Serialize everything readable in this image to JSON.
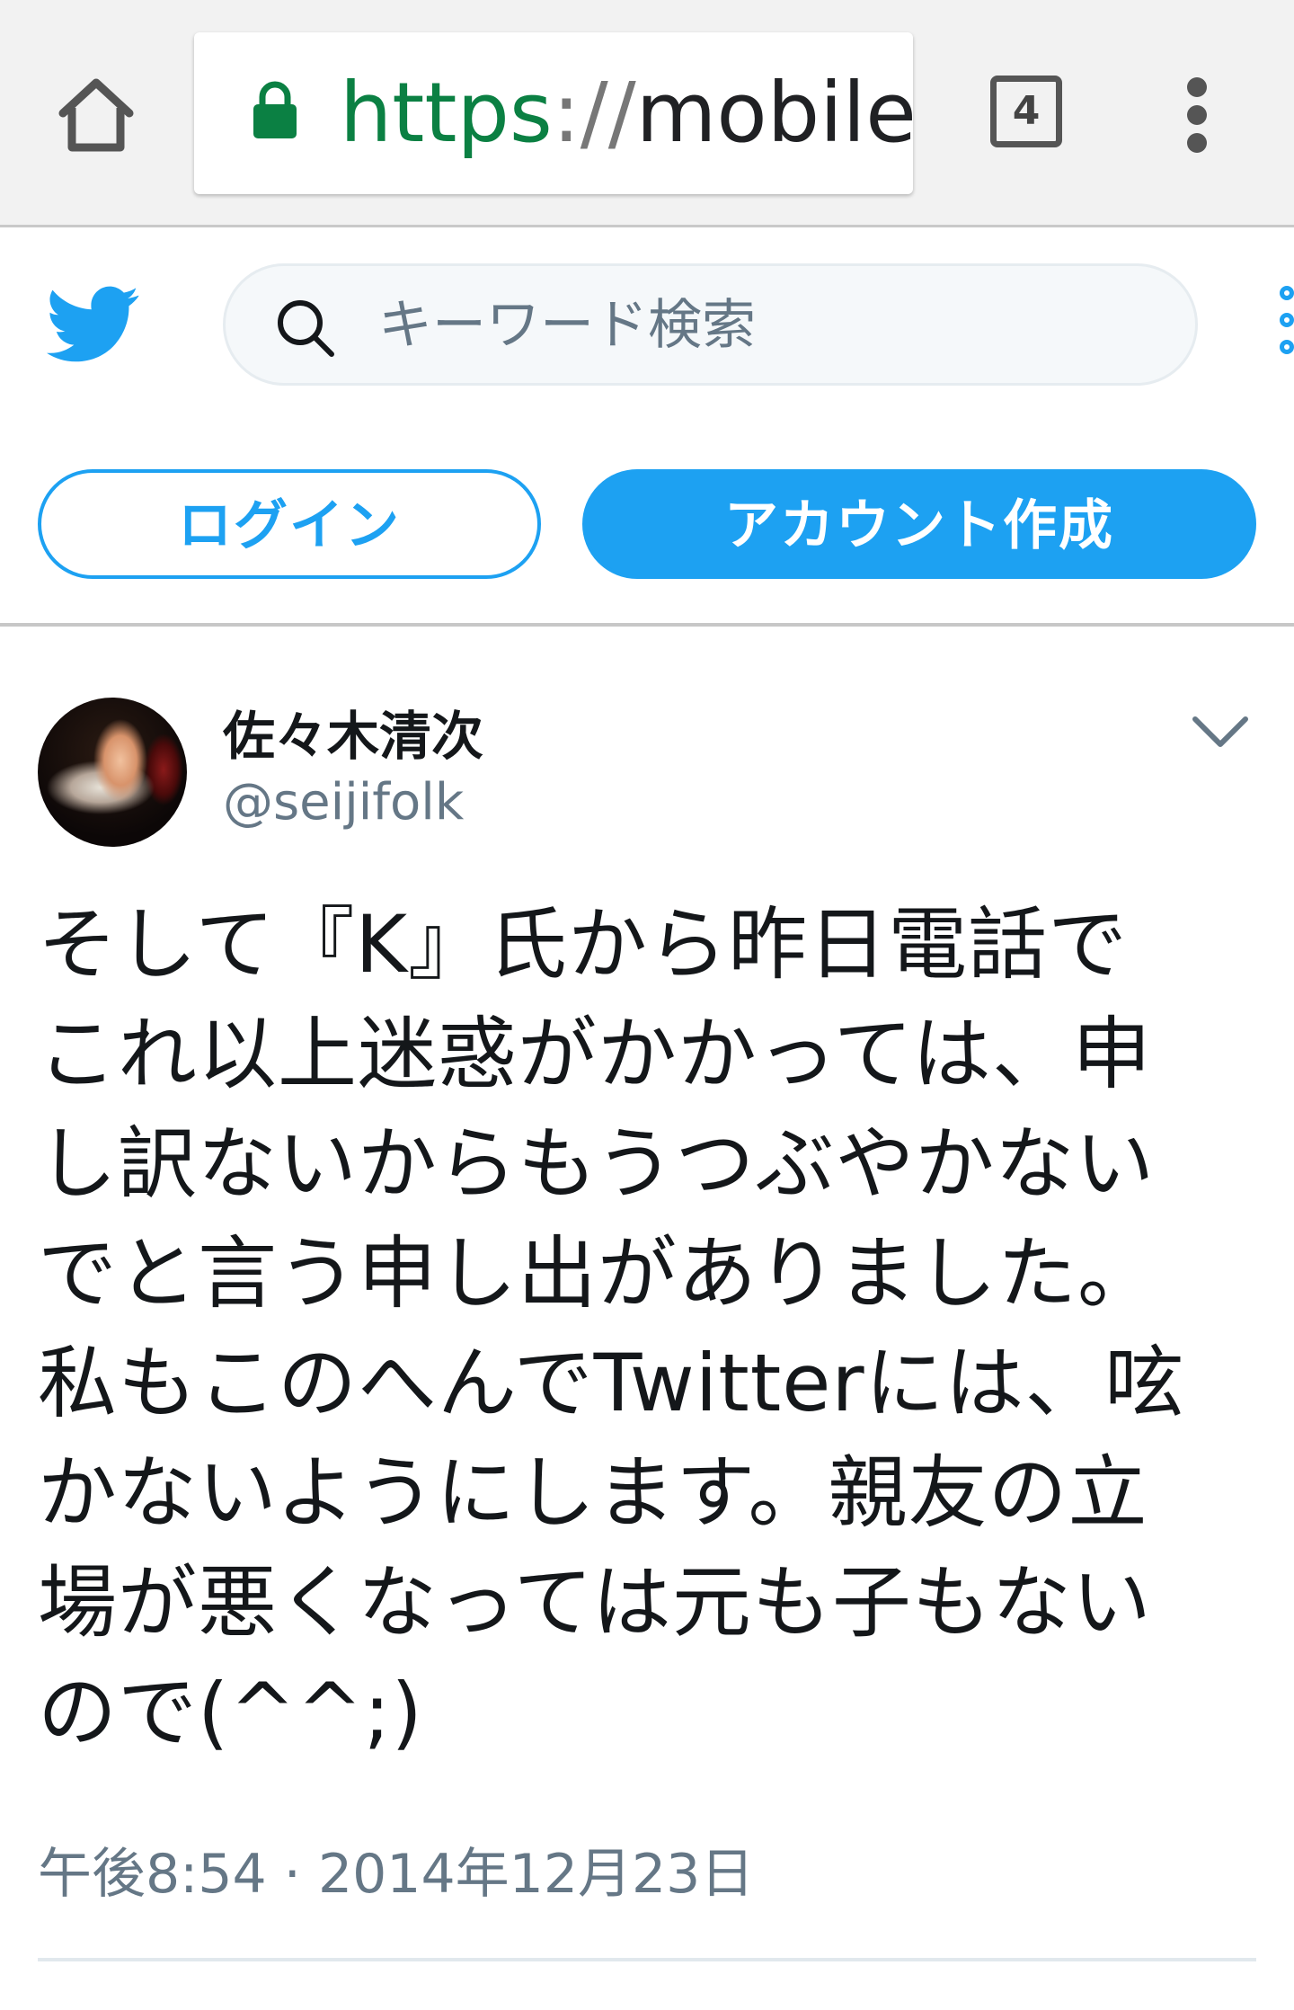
{
  "browser": {
    "url_scheme": "https",
    "url_separator": "://",
    "url_host": "mobile.",
    "tab_count": "4",
    "icons": {
      "home": "home-icon",
      "lock": "lock-icon",
      "menu": "overflow-menu-icon"
    },
    "colors": {
      "secure": "#0b8043"
    }
  },
  "header": {
    "logo": "twitter-bird-icon",
    "search": {
      "placeholder": "キーワード検索",
      "value": ""
    },
    "login_label": "ログイン",
    "signup_label": "アカウント作成",
    "colors": {
      "brand": "#1da1f2"
    }
  },
  "tweet": {
    "author_name": "佐々木清次",
    "author_handle": "@seijifolk",
    "text_lines": [
      "そして『K』氏から昨日電話で",
      "これ以上迷惑がかかっては、申",
      "し訳ないからもうつぶやかない",
      "でと言う申し出がありました。",
      "私もこのへんでTwitterには、呟",
      "かないようにします。親友の立",
      "場が悪くなっては元も子もない",
      "ので(^^;)"
    ],
    "timestamp": "午後8:54 · 2014年12月23日"
  }
}
